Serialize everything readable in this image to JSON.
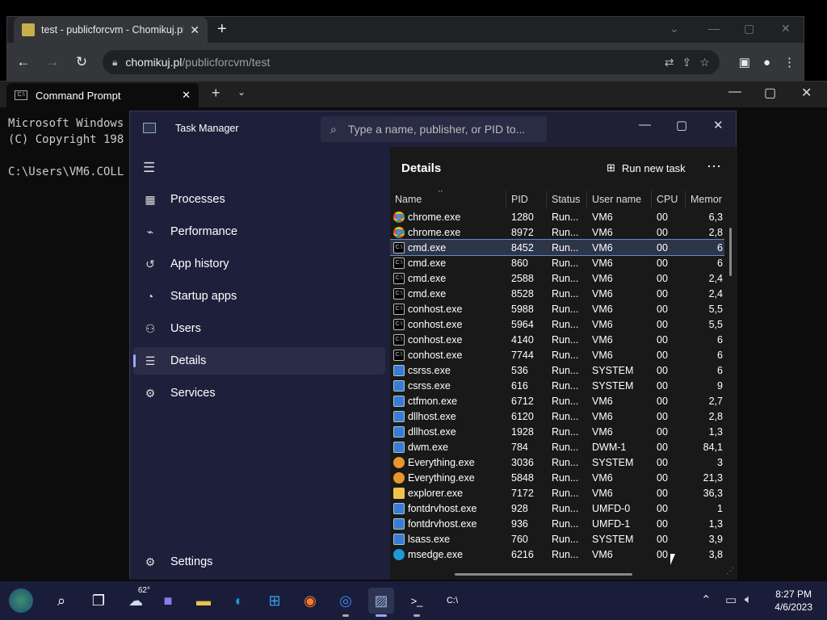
{
  "chrome": {
    "tab_title": "test - publicforcvm - Chomikuj.pl",
    "url_host": "chomikuj.pl",
    "url_path": "/publicforcvm/test"
  },
  "cmd": {
    "tab_title": "Command Prompt",
    "lines": [
      "Microsoft Windows",
      "(C) Copyright 198",
      "",
      "C:\\Users\\VM6.COLL"
    ]
  },
  "taskmgr": {
    "title": "Task Manager",
    "search_placeholder": "Type a name, publisher, or PID to...",
    "nav": [
      {
        "label": "Processes",
        "icon": "processes-icon"
      },
      {
        "label": "Performance",
        "icon": "performance-icon"
      },
      {
        "label": "App history",
        "icon": "history-icon"
      },
      {
        "label": "Startup apps",
        "icon": "startup-icon"
      },
      {
        "label": "Users",
        "icon": "users-icon"
      },
      {
        "label": "Details",
        "icon": "details-icon"
      },
      {
        "label": "Services",
        "icon": "services-icon"
      }
    ],
    "settings_label": "Settings",
    "details": {
      "heading": "Details",
      "run_new_task": "Run new task",
      "columns": [
        "Name",
        "PID",
        "Status",
        "User name",
        "CPU",
        "Memor"
      ],
      "rows": [
        [
          "chrome",
          "chrome.exe",
          "1280",
          "Run...",
          "VM6",
          "00",
          "6,3"
        ],
        [
          "chrome",
          "chrome.exe",
          "8972",
          "Run...",
          "VM6",
          "00",
          "2,8"
        ],
        [
          "cmd",
          "cmd.exe",
          "8452",
          "Run...",
          "VM6",
          "00",
          "6"
        ],
        [
          "cmd",
          "cmd.exe",
          "860",
          "Run...",
          "VM6",
          "00",
          "6"
        ],
        [
          "cmd",
          "cmd.exe",
          "2588",
          "Run...",
          "VM6",
          "00",
          "2,4"
        ],
        [
          "cmd",
          "cmd.exe",
          "8528",
          "Run...",
          "VM6",
          "00",
          "2,4"
        ],
        [
          "cmd",
          "conhost.exe",
          "5988",
          "Run...",
          "VM6",
          "00",
          "5,5"
        ],
        [
          "cmd",
          "conhost.exe",
          "5964",
          "Run...",
          "VM6",
          "00",
          "5,5"
        ],
        [
          "cmd",
          "conhost.exe",
          "4140",
          "Run...",
          "VM6",
          "00",
          "6"
        ],
        [
          "cmd",
          "conhost.exe",
          "7744",
          "Run...",
          "VM6",
          "00",
          "6"
        ],
        [
          "win",
          "csrss.exe",
          "536",
          "Run...",
          "SYSTEM",
          "00",
          "6"
        ],
        [
          "win",
          "csrss.exe",
          "616",
          "Run...",
          "SYSTEM",
          "00",
          "9"
        ],
        [
          "win",
          "ctfmon.exe",
          "6712",
          "Run...",
          "VM6",
          "00",
          "2,7"
        ],
        [
          "win",
          "dllhost.exe",
          "6120",
          "Run...",
          "VM6",
          "00",
          "2,8"
        ],
        [
          "win",
          "dllhost.exe",
          "1928",
          "Run...",
          "VM6",
          "00",
          "1,3"
        ],
        [
          "win",
          "dwm.exe",
          "784",
          "Run...",
          "DWM-1",
          "00",
          "84,1"
        ],
        [
          "find",
          "Everything.exe",
          "3036",
          "Run...",
          "SYSTEM",
          "00",
          "3"
        ],
        [
          "find",
          "Everything.exe",
          "5848",
          "Run...",
          "VM6",
          "00",
          "21,3"
        ],
        [
          "fold",
          "explorer.exe",
          "7172",
          "Run...",
          "VM6",
          "00",
          "36,3"
        ],
        [
          "win",
          "fontdrvhost.exe",
          "928",
          "Run...",
          "UMFD-0",
          "00",
          "1"
        ],
        [
          "win",
          "fontdrvhost.exe",
          "936",
          "Run...",
          "UMFD-1",
          "00",
          "1,3"
        ],
        [
          "win",
          "lsass.exe",
          "760",
          "Run...",
          "SYSTEM",
          "00",
          "3,9"
        ],
        [
          "edge",
          "msedge.exe",
          "6216",
          "Run...",
          "VM6",
          "00",
          "3,8"
        ]
      ],
      "selected_index": 2
    }
  },
  "taskbar": {
    "weather": "62°",
    "time": "8:27 PM",
    "date": "4/6/2023"
  }
}
